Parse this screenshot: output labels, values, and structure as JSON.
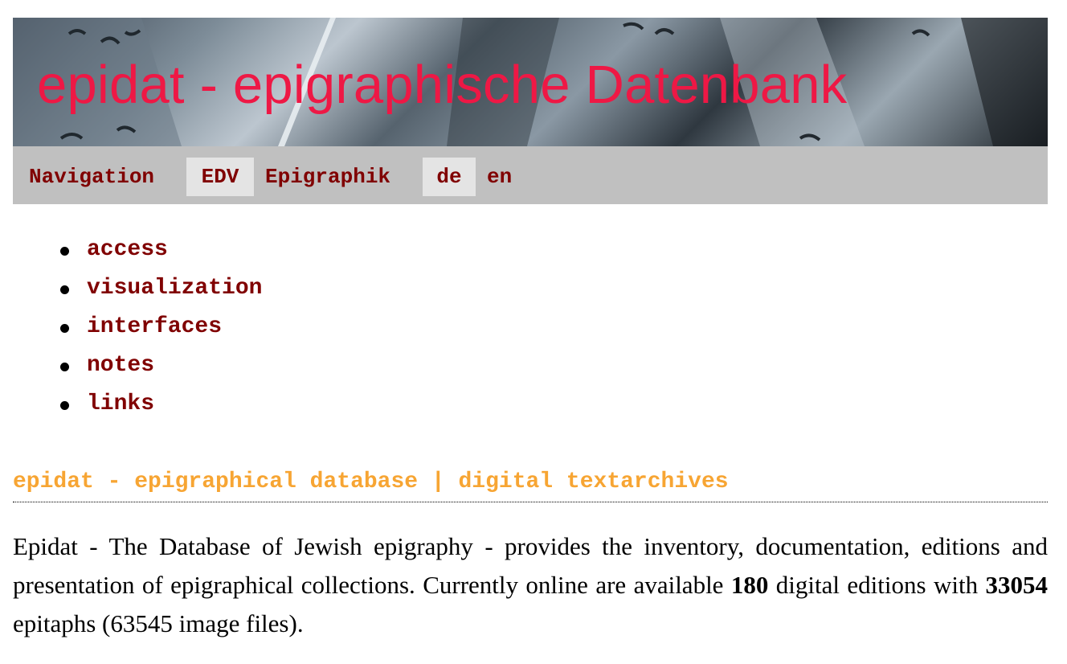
{
  "banner": {
    "title": "epidat - epigraphische Datenbank"
  },
  "navbar": {
    "items": [
      {
        "label": "Navigation",
        "active": false
      },
      {
        "label": "EDV",
        "active": true
      },
      {
        "label": "Epigraphik",
        "active": false
      },
      {
        "label": "de",
        "active": true
      },
      {
        "label": "en",
        "active": false
      }
    ]
  },
  "menu": {
    "items": [
      {
        "label": "access"
      },
      {
        "label": "visualization"
      },
      {
        "label": "interfaces"
      },
      {
        "label": "notes"
      },
      {
        "label": "links"
      }
    ]
  },
  "section": {
    "heading": "epidat - epigraphical database | digital textarchives"
  },
  "intro": {
    "text_1": "Epidat - The Database of Jewish epigraphy - provides the inventory, documentation, editions and presentation of epigraphical collections. Currently online are available ",
    "editions_count": "180",
    "text_2": " digital editions with ",
    "epitaphs_count": "33054",
    "text_3": " epitaphs (63545 image files)."
  },
  "colors": {
    "title_red": "#ee1845",
    "link_maroon": "#800000",
    "heading_orange": "#f7a533",
    "nav_background": "#c0c0c0",
    "nav_active_background": "#e4e4e4"
  },
  "icons": {
    "banner_image": "gravestone-inscription-photo",
    "list_bullet": "bullet-icon"
  }
}
